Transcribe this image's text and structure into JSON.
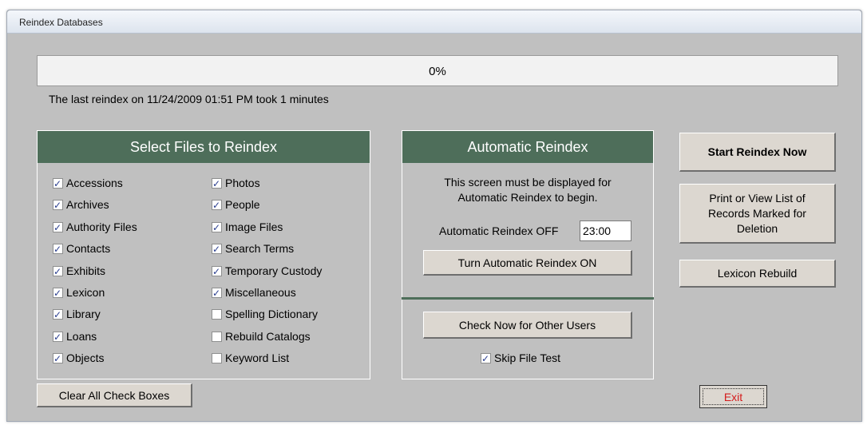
{
  "window": {
    "title": "Reindex Databases"
  },
  "progress": {
    "value": 0,
    "label": "0%"
  },
  "last_reindex": "The last reindex on 11/24/2009 01:51 PM took 1 minutes",
  "files_panel": {
    "heading": "Select Files to Reindex",
    "col1": [
      {
        "label": "Accessions",
        "checked": true
      },
      {
        "label": "Archives",
        "checked": true
      },
      {
        "label": "Authority Files",
        "checked": true
      },
      {
        "label": "Contacts",
        "checked": true
      },
      {
        "label": "Exhibits",
        "checked": true
      },
      {
        "label": "Lexicon",
        "checked": true
      },
      {
        "label": "Library",
        "checked": true
      },
      {
        "label": "Loans",
        "checked": true
      },
      {
        "label": "Objects",
        "checked": true
      }
    ],
    "col2": [
      {
        "label": "Photos",
        "checked": true
      },
      {
        "label": "People",
        "checked": true
      },
      {
        "label": "Image Files",
        "checked": true
      },
      {
        "label": "Search Terms",
        "checked": true
      },
      {
        "label": "Temporary Custody",
        "checked": true
      },
      {
        "label": "Miscellaneous",
        "checked": true
      },
      {
        "label": "Spelling Dictionary",
        "checked": false
      },
      {
        "label": "Rebuild Catalogs",
        "checked": false
      },
      {
        "label": "Keyword List",
        "checked": false
      }
    ]
  },
  "clear_button": "Clear All Check Boxes",
  "auto_panel": {
    "heading": "Automatic Reindex",
    "note_line1": "This screen must be displayed for",
    "note_line2": "Automatic Reindex to begin.",
    "status_label": "Automatic Reindex OFF",
    "time_value": "23:00",
    "turn_on_button": "Turn Automatic Reindex ON",
    "check_users_button": "Check Now for Other Users",
    "skip_file_test": {
      "label": "Skip File Test",
      "checked": true
    }
  },
  "right_buttons": {
    "start": "Start Reindex Now",
    "print_line1": "Print or View List of",
    "print_line2": "Records Marked for",
    "print_line3": "Deletion",
    "lexicon": "Lexicon Rebuild"
  },
  "exit_button": "Exit",
  "colors": {
    "panel_header": "#4e6e5a",
    "background": "#c0c0c0",
    "exit_text": "#d41c1c",
    "checkmark": "#2a3e8f"
  }
}
